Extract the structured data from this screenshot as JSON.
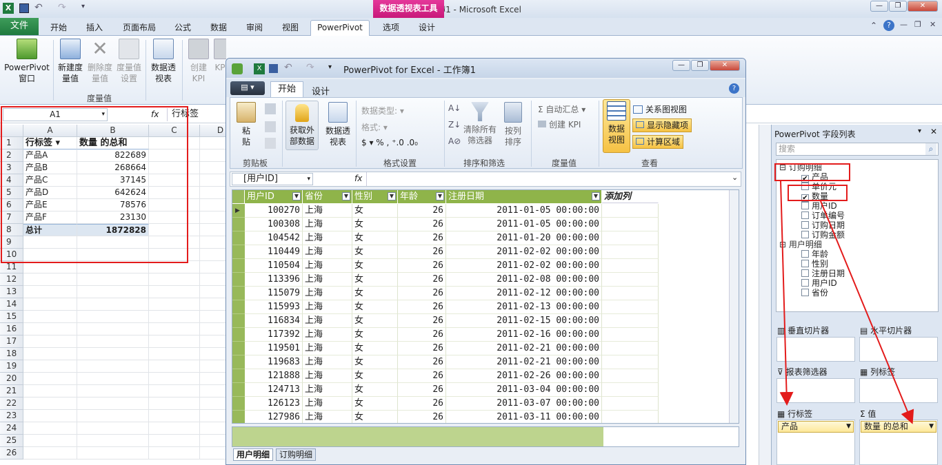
{
  "excel": {
    "title": "工作簿1  -  Microsoft Excel",
    "context_tab": "数据透视表工具",
    "tabs": [
      "文件",
      "开始",
      "插入",
      "页面布局",
      "公式",
      "数据",
      "审阅",
      "视图",
      "PowerPivot",
      "选项",
      "设计"
    ],
    "ribbon": {
      "pp_window": "PowerPivot\n窗口",
      "new_measure": "新建度\n量值",
      "delete_measure": "删除度\n量值",
      "measure_settings": "度量值\n设置",
      "group_measures": "度量值",
      "pivot_table": "数据透\n视表",
      "create_kpi": "创建\nKPI",
      "kpi_partial": "KP"
    },
    "name_box": "A1",
    "formula": "行标签",
    "fx": "fx",
    "columns": [
      "A",
      "B",
      "C",
      "D"
    ],
    "rows": [
      "1",
      "2",
      "3",
      "4",
      "5",
      "6",
      "7",
      "8",
      "9",
      "10",
      "11",
      "12",
      "13",
      "14",
      "15",
      "16",
      "17",
      "18",
      "19",
      "20",
      "21",
      "22",
      "23",
      "24",
      "25",
      "26"
    ],
    "pivot": {
      "header_a": "行标签",
      "header_b": "数量  的总和",
      "items": [
        {
          "name": "产品A",
          "value": "822689"
        },
        {
          "name": "产品B",
          "value": "268664"
        },
        {
          "name": "产品C",
          "value": "37145"
        },
        {
          "name": "产品D",
          "value": "642624"
        },
        {
          "name": "产品E",
          "value": "78576"
        },
        {
          "name": "产品F",
          "value": "23130"
        }
      ],
      "total_label": "总计",
      "total_value": "1872828"
    }
  },
  "powerpivot": {
    "title": "PowerPivot for Excel - 工作簿1",
    "tabs": [
      "开始",
      "设计"
    ],
    "ribbon": {
      "paste": "粘\n贴",
      "get_external": "获取外\n部数据",
      "pivot": "数据透\n视表",
      "data_type": "数据类型:",
      "format": "格式:",
      "clear_filters": "清除所有\n筛选器",
      "sort_by_col": "按列\n排序",
      "autosum": "自动汇总",
      "create_kpi": "创建 KPI",
      "data_view": "数据\n视图",
      "diagram_view": "关系图视图",
      "show_hidden": "显示隐藏项",
      "calc_area": "计算区域",
      "g_clipboard": "剪贴板",
      "g_format": "格式设置",
      "g_sort": "排序和筛选",
      "g_measures": "度量值",
      "g_view": "查看"
    },
    "fbar_name": "[用户ID]",
    "fx": "fx",
    "columns": [
      "用户ID",
      "省份",
      "性别",
      "年龄",
      "注册日期",
      "添加列"
    ],
    "rows": [
      [
        "100270",
        "上海",
        "女",
        "26",
        "2011-01-05 00:00:00"
      ],
      [
        "100308",
        "上海",
        "女",
        "26",
        "2011-01-05 00:00:00"
      ],
      [
        "104542",
        "上海",
        "女",
        "26",
        "2011-01-20 00:00:00"
      ],
      [
        "110449",
        "上海",
        "女",
        "26",
        "2011-02-02 00:00:00"
      ],
      [
        "110504",
        "上海",
        "女",
        "26",
        "2011-02-02 00:00:00"
      ],
      [
        "113396",
        "上海",
        "女",
        "26",
        "2011-02-08 00:00:00"
      ],
      [
        "115079",
        "上海",
        "女",
        "26",
        "2011-02-12 00:00:00"
      ],
      [
        "115993",
        "上海",
        "女",
        "26",
        "2011-02-13 00:00:00"
      ],
      [
        "116834",
        "上海",
        "女",
        "26",
        "2011-02-15 00:00:00"
      ],
      [
        "117392",
        "上海",
        "女",
        "26",
        "2011-02-16 00:00:00"
      ],
      [
        "119501",
        "上海",
        "女",
        "26",
        "2011-02-21 00:00:00"
      ],
      [
        "119683",
        "上海",
        "女",
        "26",
        "2011-02-21 00:00:00"
      ],
      [
        "121888",
        "上海",
        "女",
        "26",
        "2011-02-26 00:00:00"
      ],
      [
        "124713",
        "上海",
        "女",
        "26",
        "2011-03-04 00:00:00"
      ],
      [
        "126123",
        "上海",
        "女",
        "26",
        "2011-03-07 00:00:00"
      ],
      [
        "127986",
        "上海",
        "女",
        "26",
        "2011-03-11 00:00:00"
      ]
    ],
    "sheet_tabs": [
      "用户明细",
      "订购明细"
    ]
  },
  "fieldlist": {
    "title": "PowerPivot 字段列表",
    "search_placeholder": "搜索",
    "table1": "订购明细",
    "table1_fields": [
      {
        "name": "产品",
        "checked": true
      },
      {
        "name": "单价元",
        "checked": false
      },
      {
        "name": "数量",
        "checked": true
      },
      {
        "name": "用户ID",
        "checked": false
      },
      {
        "name": "订单编号",
        "checked": false
      },
      {
        "name": "订购日期",
        "checked": false
      },
      {
        "name": "订购金额",
        "checked": false
      }
    ],
    "table2": "用户明细",
    "table2_fields": [
      {
        "name": "年龄",
        "checked": false
      },
      {
        "name": "性别",
        "checked": false
      },
      {
        "name": "注册日期",
        "checked": false
      },
      {
        "name": "用户ID",
        "checked": false
      },
      {
        "name": "省份",
        "checked": false
      }
    ],
    "areas": {
      "v_slicer": "垂直切片器",
      "h_slicer": "水平切片器",
      "report_filter": "报表筛选器",
      "col_labels": "列标签",
      "row_labels": "行标签",
      "values": "值",
      "row_value": "产品",
      "val_value": "数量  的总和"
    }
  },
  "colors": {
    "annotation_red": "#e31b1b",
    "pivot_green": "#8fb44a",
    "context_pink": "#d4237f"
  }
}
